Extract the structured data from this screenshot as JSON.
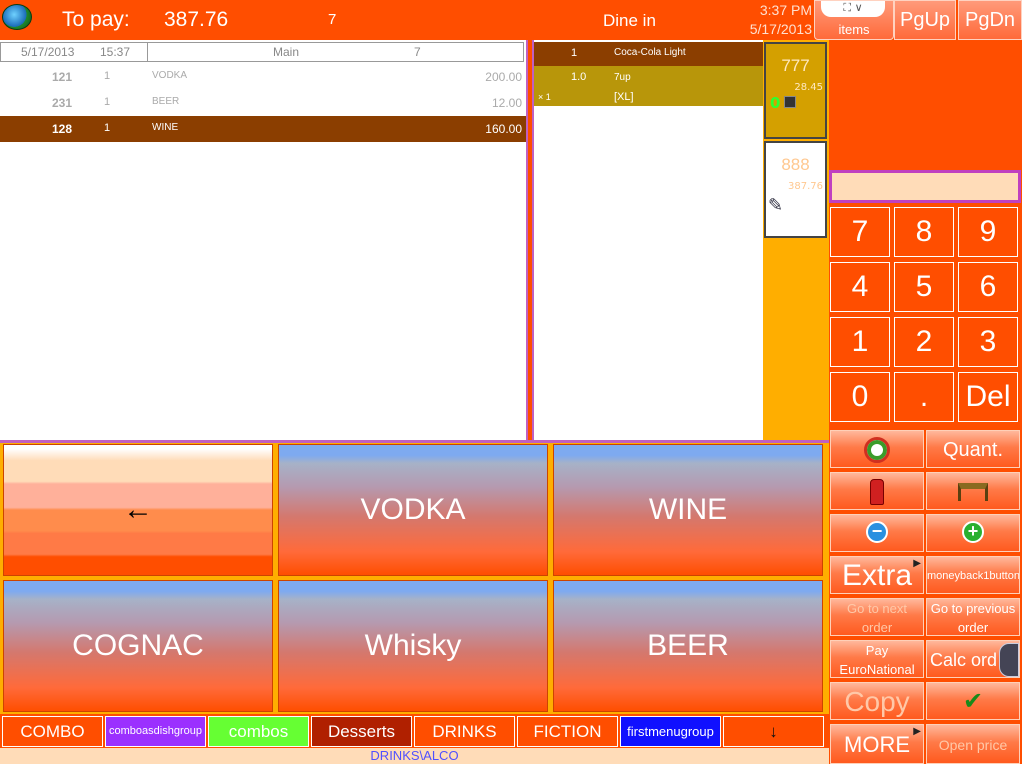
{
  "header": {
    "to_pay_label": "To pay:",
    "to_pay_amount": "387.76",
    "table_number": "7",
    "order_type": "Dine in",
    "time": "3:37 PM",
    "date": "5/17/2013",
    "items_label": "items",
    "pgup_label": "PgUp",
    "pgdn_label": "PgDn"
  },
  "order": {
    "date": "5/17/2013",
    "time": "15:37",
    "menu": "Main",
    "table": "7",
    "rows": [
      {
        "code": "121",
        "qty": "1",
        "name": "VODKA",
        "price": "200.00"
      },
      {
        "code": "231",
        "qty": "1",
        "name": "BEER",
        "price": "12.00"
      },
      {
        "code": "128",
        "qty": "1",
        "name": "WINE",
        "price": "160.00"
      }
    ]
  },
  "modifiers": [
    {
      "qty": "1",
      "name": "Coca-Cola Light"
    },
    {
      "qty": "1.0",
      "name": "7up",
      "sub_qty": "× 1",
      "sub_name": "[XL]"
    }
  ],
  "tickets": [
    {
      "number": "777",
      "amount": "28.45",
      "count": "0"
    },
    {
      "number": "888",
      "amount": "387.76"
    }
  ],
  "keypad": [
    "7",
    "8",
    "9",
    "4",
    "5",
    "6",
    "1",
    "2",
    "3",
    "0",
    ".",
    "Del"
  ],
  "functions": {
    "quant": "Quant.",
    "extra": "Extra",
    "moneyback": "moneyback1button",
    "next_order": "Go to next order",
    "prev_order": "Go to previous order",
    "pay_euro": "Pay EuroNational",
    "calc_order": "Calc ord",
    "copy": "Copy",
    "more": "MORE",
    "open_price": "Open price"
  },
  "tiles": [
    "←",
    "VODKA",
    "WINE",
    "COGNAC",
    "Whisky",
    "BEER"
  ],
  "group_tabs": [
    {
      "label": "COMBO",
      "color": "#ff4e00"
    },
    {
      "label": "comboasdishgroup",
      "color": "#9b30ff"
    },
    {
      "label": "combos",
      "color": "#66ff33"
    },
    {
      "label": "Desserts",
      "color": "#b02000"
    },
    {
      "label": "DRINKS",
      "color": "#ff4e00"
    },
    {
      "label": "FICTION",
      "color": "#ff4e00"
    },
    {
      "label": "firstmenugroup",
      "color": "#1010ff"
    },
    {
      "label": "↓",
      "color": "#ff4e00"
    }
  ],
  "status_path": "DRINKS\\ALCO"
}
